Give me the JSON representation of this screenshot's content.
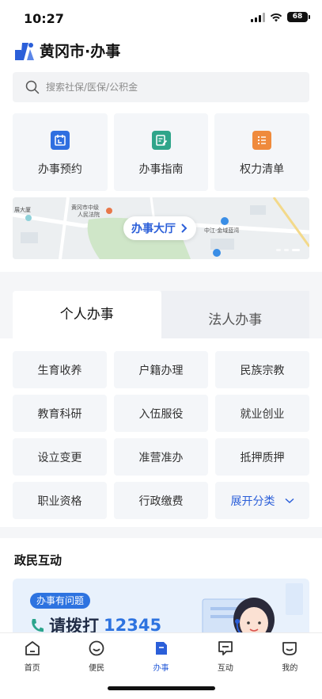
{
  "status_bar": {
    "time": "10:27",
    "battery": "68"
  },
  "header": {
    "title": "黄冈市·办事"
  },
  "search": {
    "placeholder": "搜索社保/医保/公积金"
  },
  "services": [
    {
      "label": "办事预约",
      "icon": "calendar-icon",
      "color": "#2f6fe0"
    },
    {
      "label": "办事指南",
      "icon": "guide-edit-icon",
      "color": "#2fa58a"
    },
    {
      "label": "权力清单",
      "icon": "list-icon",
      "color": "#ef8a3c"
    }
  ],
  "map_banner": {
    "button_label": "办事大厅",
    "labels": {
      "place_1": "展大厦",
      "place_2": "黄冈市中级",
      "place_3": "人民法院",
      "place_4": "中江·金域蓝湾"
    }
  },
  "tabs": [
    {
      "label": "个人办事",
      "active": true
    },
    {
      "label": "法人办事",
      "active": false
    }
  ],
  "categories": [
    "生育收养",
    "户籍办理",
    "民族宗教",
    "教育科研",
    "入伍服役",
    "就业创业",
    "设立变更",
    "准营准办",
    "抵押质押",
    "职业资格",
    "行政缴费"
  ],
  "expand_label": "展开分类",
  "interaction": {
    "title": "政民互动",
    "badge": "办事有问题",
    "call_text": "请拨打",
    "number": "12345"
  },
  "bottom_nav": [
    {
      "label": "首页",
      "icon": "home-icon",
      "active": false
    },
    {
      "label": "便民",
      "icon": "smile-icon",
      "active": false
    },
    {
      "label": "办事",
      "icon": "document-icon",
      "active": true
    },
    {
      "label": "互动",
      "icon": "chat-icon",
      "active": false
    },
    {
      "label": "我的",
      "icon": "profile-icon",
      "active": false
    }
  ],
  "colors": {
    "accent": "#2b5fd9",
    "bg_light": "#f4f6f9"
  }
}
